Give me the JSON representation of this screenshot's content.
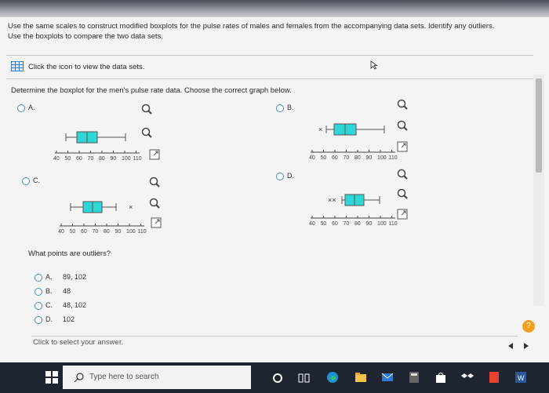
{
  "question": {
    "instruction": "Use the same scales to construct modified boxplots for the pulse rates of males and females from the accompanying data sets. Identify any outliers.",
    "instruction2": "Use the boxplots to compare the two data sets.",
    "data_link": "Click the icon to view the data sets.",
    "prompt": "Determine the boxplot for the men's pulse rate data. Choose the correct graph below."
  },
  "options": [
    {
      "letter": "A.",
      "ticks": [
        "40",
        "50",
        "60",
        "70",
        "80",
        "90",
        "100",
        "110"
      ]
    },
    {
      "letter": "B.",
      "ticks": [
        "40",
        "50",
        "60",
        "70",
        "80",
        "90",
        "100",
        "110"
      ]
    },
    {
      "letter": "C.",
      "ticks": [
        "40",
        "50",
        "60",
        "70",
        "80",
        "90",
        "100",
        "110"
      ]
    },
    {
      "letter": "D.",
      "ticks": [
        "40",
        "50",
        "60",
        "70",
        "80",
        "90",
        "100",
        "110"
      ]
    }
  ],
  "outliers": {
    "prompt": "What points are outliers?",
    "choices": [
      {
        "letter": "A.",
        "text": "89, 102"
      },
      {
        "letter": "B.",
        "text": "48"
      },
      {
        "letter": "C.",
        "text": "48, 102"
      },
      {
        "letter": "D.",
        "text": "102"
      }
    ]
  },
  "footer": {
    "click_prompt": "Click to select your answer."
  },
  "taskbar": {
    "search_placeholder": "Type here to search"
  },
  "colors": {
    "box_fill": "#2fd6d6",
    "accent": "#4a89c6",
    "help": "#f0a020"
  }
}
